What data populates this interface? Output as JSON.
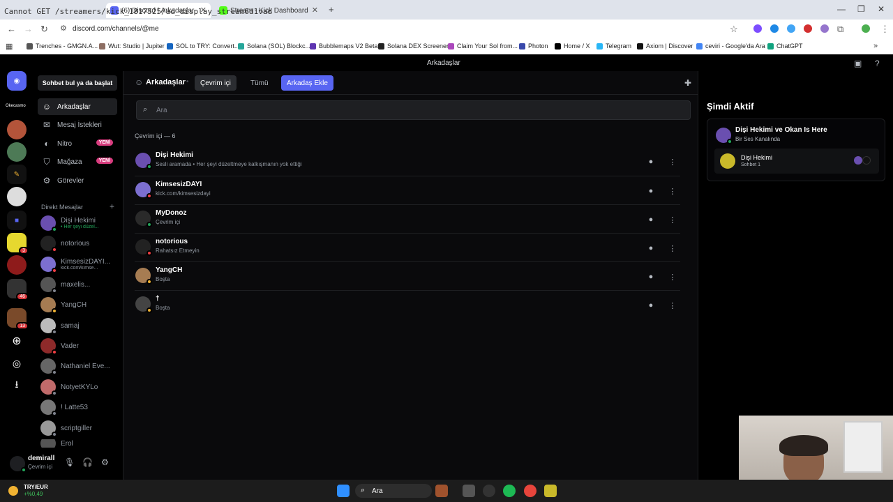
{
  "browser": {
    "overlay_text": "Cannot GET /streamers/kick_1817525/ad_display_stream6d1vad",
    "tabs": [
      {
        "title": "(6) Discord | Arkadaşlar",
        "active": true
      },
      {
        "title": "Stream - Kick Dashboard",
        "active": false
      }
    ],
    "url": "discord.com/channels/@me",
    "bookmarks": [
      "Trenches - GMGN.A...",
      "Wut: Studio | Jupiter",
      "SOL to TRY: Convert...",
      "Solana (SOL) Blockc...",
      "Bubblemaps V2 Beta",
      "Solana DEX Screener",
      "Claim Your Sol from...",
      "Photon",
      "Home / X",
      "Telegram",
      "Axiom | Discover",
      "ceviri - Google'da Ara",
      "ChatGPT"
    ]
  },
  "discord": {
    "window_title": "Arkadaşlar",
    "server_badges": {
      "a": "3",
      "b": "46",
      "c": "13"
    },
    "server_label": "Okecasmo",
    "search_conversation": "Sohbet bul ya da başlat",
    "nav": [
      {
        "label": "Arkadaşlar",
        "icon": "friends-icon"
      },
      {
        "label": "Mesaj İstekleri",
        "icon": "mail-icon"
      },
      {
        "label": "Nitro",
        "icon": "nitro-icon",
        "badge": "YENİ"
      },
      {
        "label": "Mağaza",
        "icon": "shop-icon",
        "badge": "YENİ"
      },
      {
        "label": "Görevler",
        "icon": "quests-icon"
      }
    ],
    "dm_header": "Direkt Mesajlar",
    "dms": [
      {
        "name": "Dişi Hekimi",
        "sub": "• Her şeyi düzel...",
        "status": "online"
      },
      {
        "name": "notorious",
        "sub": "",
        "status": "dnd"
      },
      {
        "name": "KimsesizDAYI...",
        "sub": "kick.com/kimse...",
        "status": "dnd"
      },
      {
        "name": "maxelis...",
        "sub": "",
        "status": "offline"
      },
      {
        "name": "YangCH",
        "sub": "",
        "status": "idle"
      },
      {
        "name": "samaj",
        "sub": "",
        "status": "offline"
      },
      {
        "name": "Vader",
        "sub": "",
        "status": "dnd"
      },
      {
        "name": "Nathaniel Eve...",
        "sub": "",
        "status": "offline"
      },
      {
        "name": "NotyetKYLo",
        "sub": "",
        "status": "offline"
      },
      {
        "name": "! Latte53",
        "sub": "",
        "status": "offline"
      },
      {
        "name": "scriptgiller",
        "sub": "",
        "status": "offline"
      },
      {
        "name": "Erol",
        "sub": "",
        "status": "offline"
      }
    ],
    "user": {
      "name": "demirall",
      "status": "Çevrim içi"
    },
    "header": {
      "title": "Arkadaşlar",
      "tab_online": "Çevrim içi",
      "tab_all": "Tümü",
      "add_friend": "Arkadaş Ekle"
    },
    "search_placeholder": "Ara",
    "online_count": "Çevrim içi — 6",
    "friends": [
      {
        "name": "Dişi Hekimi",
        "sub": "Sesli aramada • Her şeyi düzeltmeye kalkışmanın yok ettiği",
        "status": "online"
      },
      {
        "name": "KimsesizDAYI",
        "sub": "kick.com/kimsesizdayi",
        "status": "dnd"
      },
      {
        "name": "MyDonoz",
        "sub": "Çevrim içi",
        "status": "online"
      },
      {
        "name": "notorious",
        "sub": "Rahatsız Etmeyin",
        "status": "dnd"
      },
      {
        "name": "YangCH",
        "sub": "Boşta",
        "status": "idle"
      },
      {
        "name": "†",
        "sub": "Boşta",
        "status": "idle"
      }
    ],
    "active_now": {
      "title": "Şimdi Aktif",
      "card_title": "Dişi Hekimi ve Okan Is Here",
      "card_sub": "Bir Ses Kanalında",
      "inner_name": "Dişi Hekimi",
      "inner_sub": "Sohbet 1"
    }
  },
  "taskbar": {
    "ticker": "TRY/EUR",
    "ticker_change": "+%0,49",
    "search": "Ara"
  },
  "colors": {
    "online": "#23a55a",
    "dnd": "#f23f43",
    "idle": "#f0b232",
    "offline": "#80848e",
    "blurple": "#5865f2"
  }
}
